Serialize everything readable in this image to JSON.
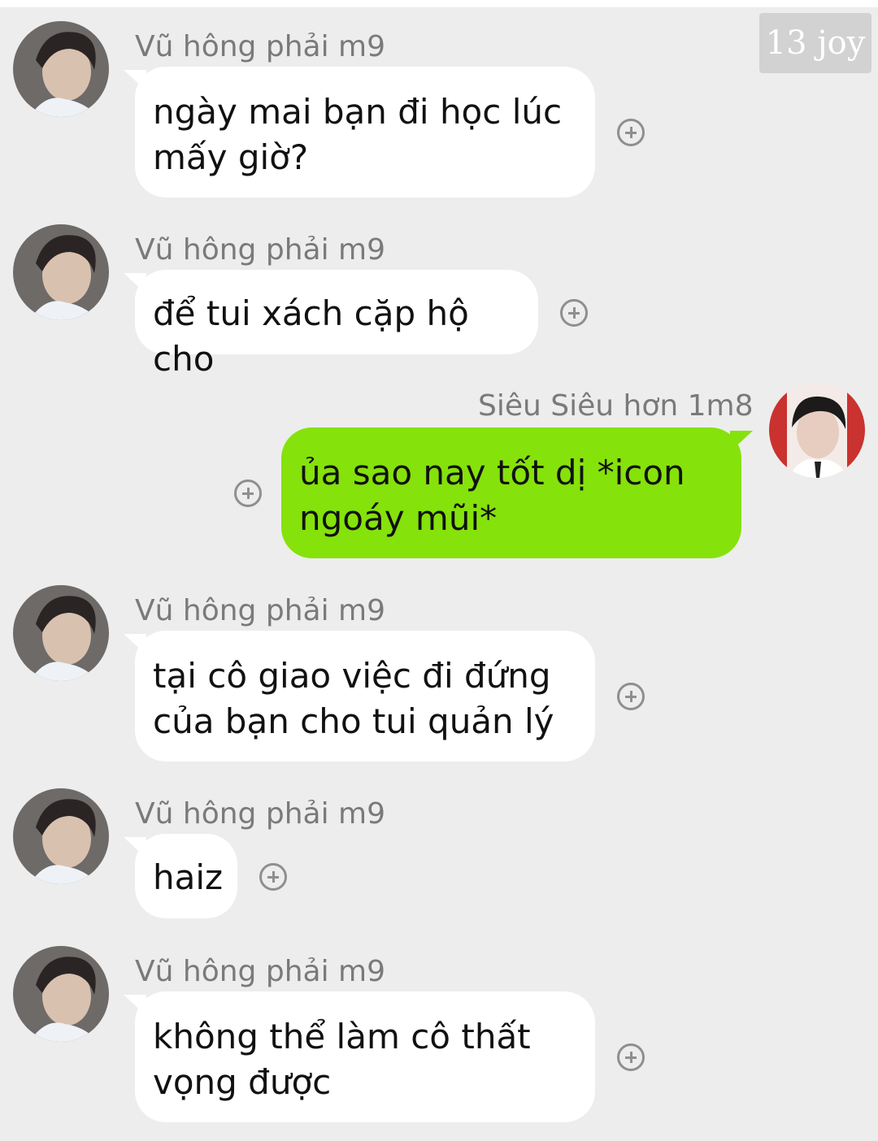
{
  "watermark": "13 joy",
  "colors": {
    "background": "#ededed",
    "incoming_bubble": "#ffffff",
    "outgoing_bubble": "#85e20a",
    "sender_text": "#7a7a7a"
  },
  "messages": [
    {
      "sender": "Vũ hông phải m9",
      "text": "ngày mai bạn đi học lúc\nmấy giờ?",
      "direction": "incoming"
    },
    {
      "sender": "Vũ hông phải m9",
      "text": "để tui xách cặp hộ cho",
      "direction": "incoming"
    },
    {
      "sender": "Siêu Siêu hơn 1m8",
      "text": "ủa sao nay tốt dị *icon\nngoáy mũi*",
      "direction": "outgoing"
    },
    {
      "sender": "Vũ hông phải m9",
      "text": "tại cô giao việc đi đứng\ncủa bạn cho tui quản lý",
      "direction": "incoming"
    },
    {
      "sender": "Vũ hông phải m9",
      "text": "haiz",
      "direction": "incoming"
    },
    {
      "sender": "Vũ hông phải m9",
      "text": "không thể làm cô thất\nvọng được",
      "direction": "incoming"
    }
  ],
  "icons": {
    "add_reaction": "plus-circle-icon",
    "avatar": "user-avatar-icon"
  }
}
